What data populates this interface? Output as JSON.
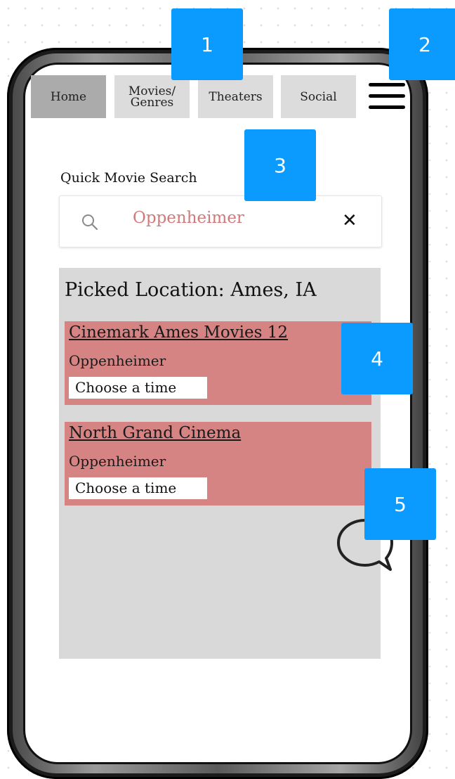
{
  "nav": {
    "home": "Home",
    "movies_line1": "Movies/",
    "movies_line2": "Genres",
    "theaters": "Theaters",
    "social": "Social",
    "menu_icon": "hamburger-icon"
  },
  "search": {
    "label": "Quick Movie Search",
    "value": "Oppenheimer",
    "clear": "✕",
    "icon": "search-icon"
  },
  "results": {
    "location": "Picked Location: Ames, IA",
    "cards": [
      {
        "theater": "Cinemark Ames Movies 12",
        "movie": "Oppenheimer",
        "button": "Choose a time"
      },
      {
        "theater": "North Grand Cinema",
        "movie": "Oppenheimer",
        "button": "Choose a time"
      }
    ]
  },
  "chat": {
    "icon": "chat-bubble-icon"
  },
  "markers": [
    "1",
    "2",
    "3",
    "4",
    "5"
  ],
  "colors": {
    "nav_bg": "#dcdcdc",
    "nav_active_bg": "#ababab",
    "card_bg": "#d58383",
    "results_bg": "#d9d9d9",
    "search_text": "#d07b7b",
    "marker_bg": "#0b9bff"
  }
}
